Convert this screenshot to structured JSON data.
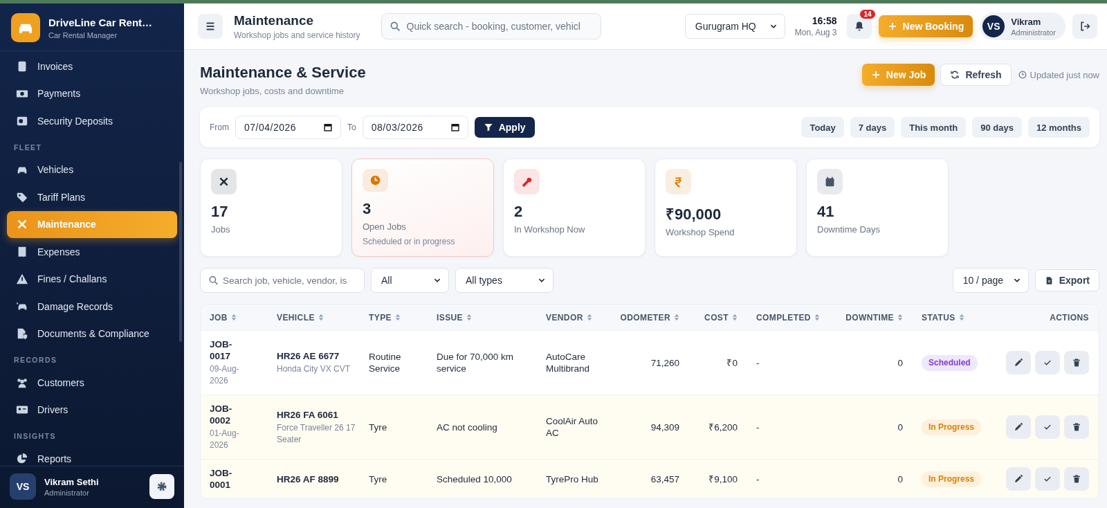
{
  "sidebar": {
    "brand": {
      "title": "DriveLine Car Rent…",
      "subtitle": "Car Rental Manager"
    },
    "sections": [
      {
        "items": [
          {
            "label": "Invoices",
            "selected": false
          },
          {
            "label": "Payments",
            "selected": false
          },
          {
            "label": "Security Deposits",
            "selected": false
          }
        ]
      },
      {
        "heading": "FLEET",
        "items": [
          {
            "label": "Vehicles",
            "selected": false
          },
          {
            "label": "Tariff Plans",
            "selected": false
          },
          {
            "label": "Maintenance",
            "selected": true
          },
          {
            "label": "Expenses",
            "selected": false
          },
          {
            "label": "Fines / Challans",
            "selected": false
          },
          {
            "label": "Damage Records",
            "selected": false
          },
          {
            "label": "Documents & Compliance",
            "selected": false
          }
        ]
      },
      {
        "heading": "RECORDS",
        "items": [
          {
            "label": "Customers",
            "selected": false
          },
          {
            "label": "Drivers",
            "selected": false
          }
        ]
      },
      {
        "heading": "INSIGHTS",
        "items": [
          {
            "label": "Reports",
            "selected": false
          }
        ]
      }
    ],
    "user": {
      "initials": "VS",
      "name": "Vikram Sethi",
      "role": "Administrator"
    }
  },
  "topbar": {
    "title": "Maintenance",
    "subtitle": "Workshop jobs and service history",
    "search": {
      "placeholder": "Quick search - booking, customer, vehicl"
    },
    "branch": "Gurugram HQ",
    "time": "16:58",
    "date": "Mon, Aug 3",
    "notifications": "14",
    "new_booking": "New Booking",
    "user": {
      "initials": "VS",
      "name": "Vikram",
      "role": "Administrator"
    }
  },
  "page": {
    "title": "Maintenance & Service",
    "subtitle": "Workshop jobs, costs and downtime",
    "new_job": "New Job",
    "refresh": "Refresh",
    "updated": "Updated just now"
  },
  "filters": {
    "from_label": "From",
    "from": "07/04/2026",
    "to_label": "To",
    "to": "08/03/2026",
    "apply": "Apply",
    "ranges": [
      "Today",
      "7 days",
      "This month",
      "90 days",
      "12 months"
    ]
  },
  "stats": [
    {
      "value": "17",
      "label": "Jobs",
      "color": "#1e293b",
      "highlighted": false
    },
    {
      "value": "3",
      "label": "Open Jobs",
      "note": "Scheduled or in progress",
      "color": "#d97706",
      "highlighted": true
    },
    {
      "value": "2",
      "label": "In Workshop Now",
      "color": "#dc2626",
      "highlighted": false
    },
    {
      "value": "₹90,000",
      "label": "Workshop Spend",
      "color": "#d97706",
      "highlighted": false
    },
    {
      "value": "41",
      "label": "Downtime Days",
      "color": "#475569",
      "highlighted": false
    }
  ],
  "toolbar": {
    "search": {
      "placeholder": "Search job, vehicle, vendor, is"
    },
    "status_filter": "All",
    "type_filter": "All types",
    "page_size": "10 / page",
    "export": "Export"
  },
  "table": {
    "columns": [
      {
        "label": "JOB",
        "sortable": true
      },
      {
        "label": "VEHICLE",
        "sortable": true
      },
      {
        "label": "TYPE",
        "sortable": true
      },
      {
        "label": "ISSUE",
        "sortable": true
      },
      {
        "label": "VENDOR",
        "sortable": true
      },
      {
        "label": "ODOMETER",
        "sortable": true
      },
      {
        "label": "COST",
        "sortable": true
      },
      {
        "label": "COMPLETED",
        "sortable": true
      },
      {
        "label": "DOWNTIME",
        "sortable": true
      },
      {
        "label": "STATUS",
        "sortable": true
      },
      {
        "label": "ACTIONS",
        "sortable": false
      }
    ],
    "rows": [
      {
        "job": "JOB-0017",
        "date": "09-Aug-2026",
        "plate": "HR26 AE 6677",
        "model": "Honda City VX CVT",
        "type": "Routine Service",
        "issue": "Due for 70,000 km service",
        "vendor": "AutoCare Multibrand",
        "odometer": "71,260",
        "cost": "₹0",
        "completed": "-",
        "downtime": "0",
        "status": {
          "label": "Scheduled",
          "kind": "scheduled"
        }
      },
      {
        "job": "JOB-0002",
        "date": "01-Aug-2026",
        "plate": "HR26 FA 6061",
        "model": "Force Traveller 26 17 Seater",
        "type": "Tyre",
        "issue": "AC not cooling",
        "vendor": "CoolAir Auto AC",
        "odometer": "94,309",
        "cost": "₹6,200",
        "completed": "-",
        "downtime": "0",
        "status": {
          "label": "In Progress",
          "kind": "in_progress"
        }
      },
      {
        "job": "JOB-0001",
        "plate": "HR26 AF 8899",
        "type": "Tyre",
        "issue": "Scheduled 10,000",
        "vendor": "TyrePro Hub",
        "odometer": "63,457",
        "cost": "₹9,100",
        "completed": "-",
        "downtime": "0",
        "status": {
          "label": "In Progress",
          "kind": "in_progress"
        }
      }
    ]
  }
}
